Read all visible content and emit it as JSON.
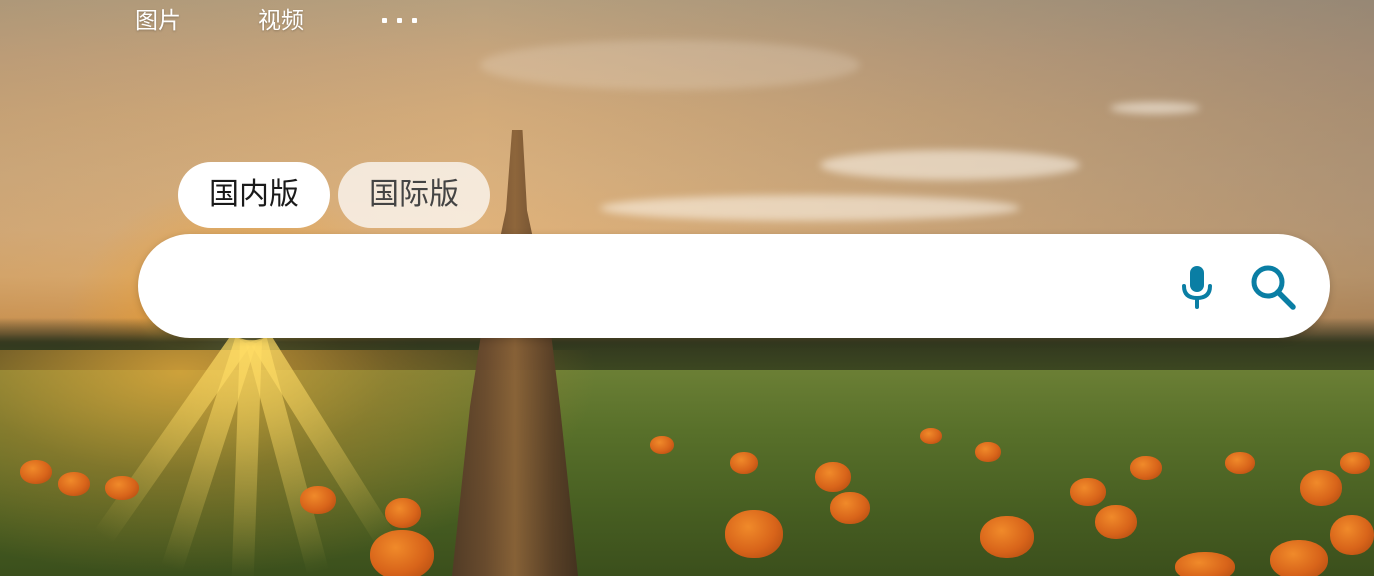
{
  "top_nav": {
    "items": [
      {
        "label": "图片"
      },
      {
        "label": "视频"
      }
    ],
    "more_icon": "more-dots-icon"
  },
  "version_tabs": [
    {
      "label": "国内版",
      "selected": true
    },
    {
      "label": "国际版",
      "selected": false
    }
  ],
  "search": {
    "value": "",
    "placeholder": "",
    "mic_icon": "microphone-icon",
    "search_icon": "search-icon"
  },
  "colors": {
    "accent": "#0a7ea4",
    "search_box": "#ffffff",
    "nav_text": "#ffffff"
  }
}
